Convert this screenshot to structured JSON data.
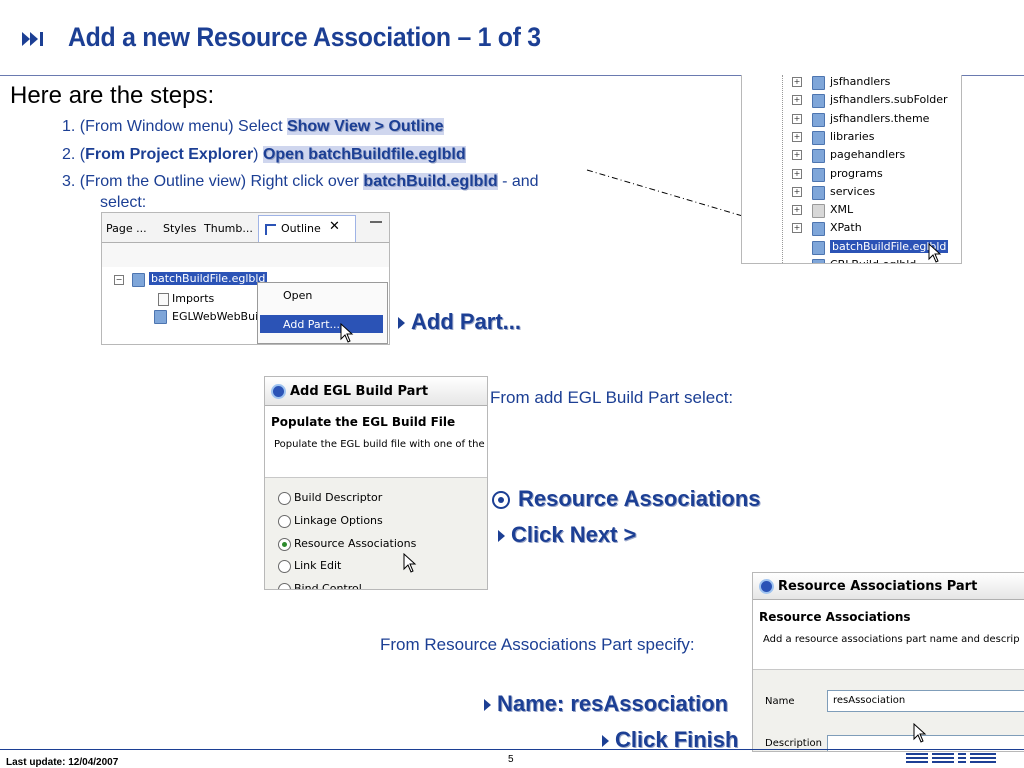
{
  "slide": {
    "title": "Add a new Resource Association – 1 of 3",
    "intro": "Here are the steps:",
    "steps": [
      {
        "prefix": "1. (From Window menu) Select ",
        "bold": "Show View  > Outline"
      },
      {
        "prefix": "2. (",
        "bold_a": "From Project Explorer",
        "mid": ") ",
        "bold": "Open batchBuildfile.eglbld"
      },
      {
        "prefix": "3. (From the Outline view) Right click over ",
        "bold": "batchBuild.eglbld",
        "suffix": " - and",
        "cont": "select:"
      }
    ],
    "bullet_add_part": "Add Part...",
    "caption_add_egl": "From add EGL Build Part select:",
    "bullet_resource": "Resource Associations",
    "bullet_click_next": "Click Next >",
    "caption_resource_part": "From Resource Associations Part specify:",
    "bullet_name": "Name: resAssociation",
    "bullet_click_finish": "Click Finish",
    "footer": "Last update: 12/04/2007",
    "page_number": "5"
  },
  "outline_shot": {
    "tabs": [
      "Page ...",
      "Styles",
      "Thumb...",
      "Outline"
    ],
    "tree": [
      "batchBuildFile.eglbld",
      "Imports",
      "EGLWebWebBuil"
    ],
    "menu": [
      "Open",
      "Add Part..."
    ]
  },
  "explorer_shot": {
    "items": [
      "jsfhandlers",
      "jsfhandlers.subFolder",
      "jsfhandlers.theme",
      "libraries",
      "pagehandlers",
      "programs",
      "services",
      "XML",
      "XPath",
      "batchBuildFile.eglbld",
      "CBLBuild.eglbld"
    ]
  },
  "egl_dialog": {
    "title": "Add EGL Build Part",
    "heading": "Populate the EGL Build File",
    "description": "Populate the EGL build file with one of the",
    "options": [
      "Build Descriptor",
      "Linkage Options",
      "Resource Associations",
      "Link Edit",
      "Bind Control"
    ],
    "selected": "Resource Associations"
  },
  "resource_dialog": {
    "title": "Resource Associations Part",
    "heading": "Resource Associations",
    "description": "Add a resource associations part name and descrip",
    "name_label": "Name",
    "name_value": "resAssociation",
    "description_label": "Description"
  },
  "colors": {
    "accent": "#1c3f94",
    "selection": "#2b53b6"
  }
}
